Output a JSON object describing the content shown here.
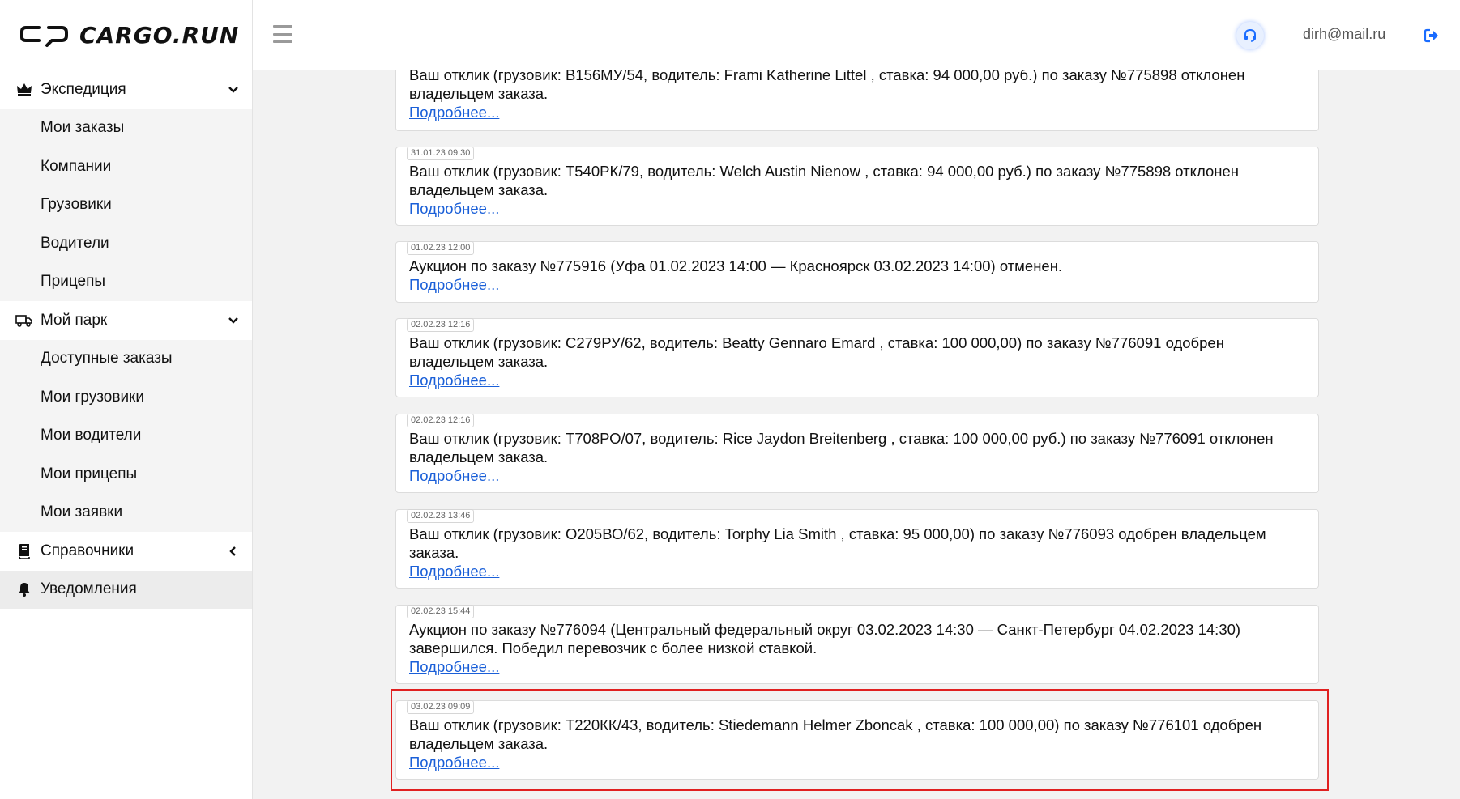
{
  "header": {
    "logo_text": "CARGO.RUN",
    "user_email": "dirh@mail.ru",
    "icons": {
      "menu": "hamburger-icon",
      "support": "headset-icon",
      "logout": "logout-icon"
    },
    "accent_color": "#1a6cff"
  },
  "sidebar": {
    "sections": [
      {
        "label": "Экспедиция",
        "icon": "crown-icon",
        "chevron": "down",
        "items": [
          "Мои заказы",
          "Компании",
          "Грузовики",
          "Водители",
          "Прицепы"
        ]
      },
      {
        "label": "Мой парк",
        "icon": "truck-icon",
        "chevron": "down",
        "items": [
          "Доступные заказы",
          "Мои грузовики",
          "Мои водители",
          "Мои прицепы",
          "Мои заявки"
        ]
      },
      {
        "label": "Справочники",
        "icon": "book-icon",
        "chevron": "left",
        "items": []
      },
      {
        "label": "Уведомления",
        "icon": "bell-icon",
        "chevron": "",
        "items": [],
        "active": true
      }
    ]
  },
  "notifications": [
    {
      "timestamp": "",
      "text": "Ваш отклик (грузовик: В156МУ/54, водитель:  Frami Katherine Littel , ставка: 94 000,00 руб.) по заказу №775898 отклонен владельцем заказа.",
      "more": "Подробнее..."
    },
    {
      "timestamp": "31.01.23 09:30",
      "text": "Ваш отклик (грузовик: Т540РК/79, водитель:  Welch Austin Nienow , ставка: 94 000,00 руб.) по заказу №775898 отклонен владельцем заказа.",
      "more": "Подробнее..."
    },
    {
      "timestamp": "01.02.23 12:00",
      "text": "Аукцион по заказу №775916 (Уфа 01.02.2023 14:00 — Красноярск 03.02.2023 14:00) отменен.",
      "more": "Подробнее..."
    },
    {
      "timestamp": "02.02.23 12:16",
      "text": "Ваш отклик (грузовик: С279РУ/62, водитель:  Beatty Gennaro Emard , ставка: 100 000,00) по заказу №776091 одобрен владельцем заказа.",
      "more": "Подробнее..."
    },
    {
      "timestamp": "02.02.23 12:16",
      "text": "Ваш отклик (грузовик: Т708РО/07, водитель:  Rice Jaydon Breitenberg , ставка: 100 000,00 руб.) по заказу №776091 отклонен владельцем заказа.",
      "more": "Подробнее..."
    },
    {
      "timestamp": "02.02.23 13:46",
      "text": "Ваш отклик (грузовик: О205ВО/62, водитель:  Torphy Lia Smith , ставка: 95 000,00) по заказу №776093 одобрен владельцем заказа.",
      "more": "Подробнее..."
    },
    {
      "timestamp": "02.02.23 15:44",
      "text": "Аукцион по заказу №776094 (Центральный федеральный округ 03.02.2023 14:30 — Санкт-Петербург 04.02.2023 14:30) завершился. Победил перевозчик с более низкой ставкой.",
      "more": "Подробнее..."
    },
    {
      "timestamp": "03.02.23 09:09",
      "text": "Ваш отклик (грузовик: Т220КК/43, водитель:  Stiedemann Helmer Zboncak , ставка: 100 000,00) по заказу №776101 одобрен владельцем заказа.",
      "more": "Подробнее...",
      "highlighted": true
    }
  ]
}
